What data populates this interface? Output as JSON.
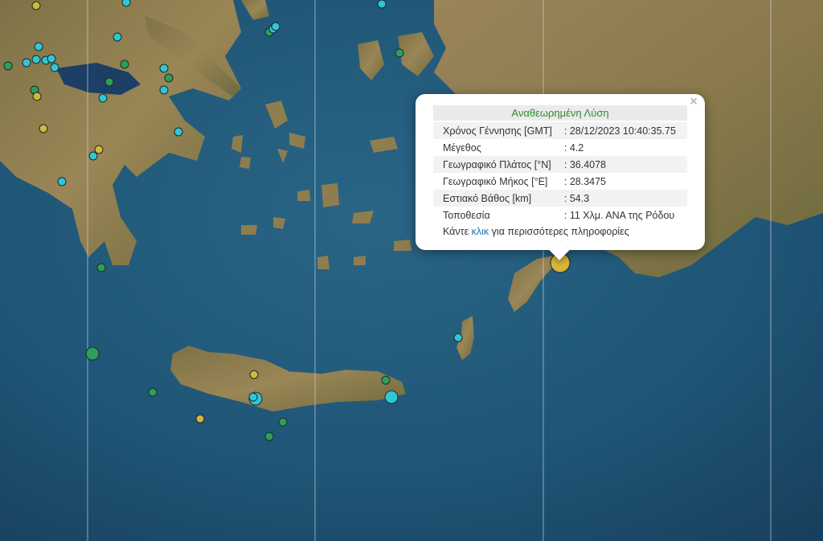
{
  "popup": {
    "title": "Αναθεωρημένη Λύση",
    "close_icon": "close-icon",
    "rows": [
      {
        "label": "Χρόνος Γέννησης [GMT]",
        "value": "28/12/2023 10:40:35.75"
      },
      {
        "label": "Μέγεθος",
        "value": "4.2"
      },
      {
        "label": "Γεωγραφικό Πλάτος [°N]",
        "value": "36.4078"
      },
      {
        "label": "Γεωγραφικό Μήκος [°E]",
        "value": "28.3475"
      },
      {
        "label": "Εστιακό Βάθος [km]",
        "value": "54.3"
      },
      {
        "label": "Τοποθεσία",
        "value": "11 Χλμ. ΑΝΑ της Ρόδου"
      }
    ],
    "more_prefix": "Κάντε",
    "more_link": "κλικ",
    "more_suffix": "για περισσότερες πληροφορίες"
  },
  "colors": {
    "sea": "#1f4f6e",
    "land": "#8a7a4c",
    "quake_yellow": "#d6b53a",
    "quake_cyan": "#2fc6d6",
    "quake_green": "#2e9e5a",
    "title_green": "#2e8b2e",
    "link_blue": "#1f74b5"
  }
}
